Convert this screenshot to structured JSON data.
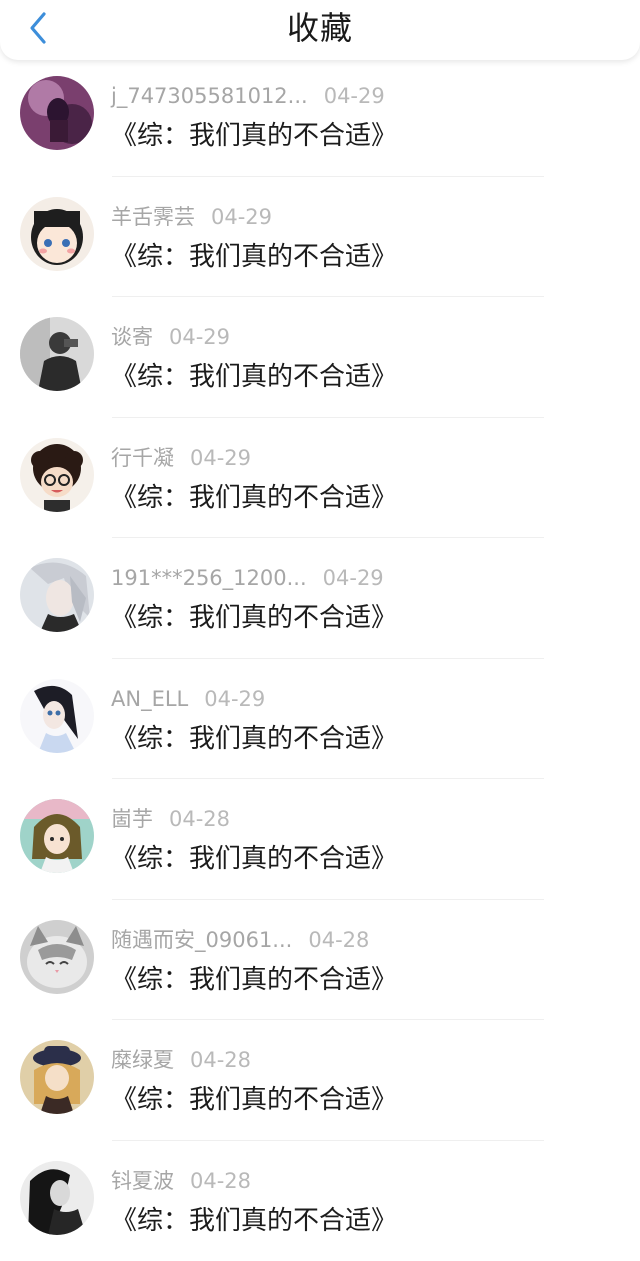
{
  "header": {
    "title": "收藏",
    "back_icon": "chevron-left-icon",
    "accent_color": "#3d8eda"
  },
  "items": [
    {
      "username": "j_747305581012...",
      "date": "04-29",
      "title": "《综：我们真的不合适》",
      "avatar_icon": "avatar-icon"
    },
    {
      "username": "羊舌霁芸",
      "date": "04-29",
      "title": "《综：我们真的不合适》",
      "avatar_icon": "avatar-icon"
    },
    {
      "username": "谈寄",
      "date": "04-29",
      "title": "《综：我们真的不合适》",
      "avatar_icon": "avatar-icon"
    },
    {
      "username": "行千凝",
      "date": "04-29",
      "title": "《综：我们真的不合适》",
      "avatar_icon": "avatar-icon"
    },
    {
      "username": "191***256_1200...",
      "date": "04-29",
      "title": "《综：我们真的不合适》",
      "avatar_icon": "avatar-icon"
    },
    {
      "username": "AN_ELL",
      "date": "04-29",
      "title": "《综：我们真的不合适》",
      "avatar_icon": "avatar-icon"
    },
    {
      "username": "崮芋",
      "date": "04-28",
      "title": "《综：我们真的不合适》",
      "avatar_icon": "avatar-icon"
    },
    {
      "username": "随遇而安_09061...",
      "date": "04-28",
      "title": "《综：我们真的不合适》",
      "avatar_icon": "avatar-icon"
    },
    {
      "username": "糜绿夏",
      "date": "04-28",
      "title": "《综：我们真的不合适》",
      "avatar_icon": "avatar-icon"
    },
    {
      "username": "钭夏波",
      "date": "04-28",
      "title": "《综：我们真的不合适》",
      "avatar_icon": "avatar-icon"
    }
  ]
}
